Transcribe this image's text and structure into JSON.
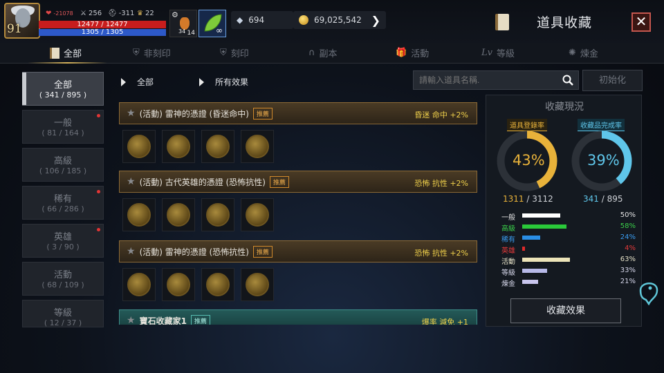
{
  "player": {
    "level": "91",
    "stat_a": "-21078",
    "stat_b": "256",
    "stat_c": "-311",
    "stat_d": "22",
    "hp": "12477 / 12477",
    "mp": "1305 / 1305",
    "slot1_count": "34",
    "slot1_sub": "14",
    "slot2_badge": "∞"
  },
  "currency": {
    "gems": "694",
    "gold": "69,025,542"
  },
  "header": {
    "title": "道具收藏",
    "close": "✕"
  },
  "tabs": [
    "全部",
    "非刻印",
    "刻印",
    "副本",
    "活動",
    "等級",
    "煉金"
  ],
  "sidebar": [
    {
      "name": "全部",
      "count": "( 341 / 895 )"
    },
    {
      "name": "一般",
      "count": "( 81 / 164 )"
    },
    {
      "name": "高級",
      "count": "( 106 / 185 )"
    },
    {
      "name": "稀有",
      "count": "( 66 / 286 )"
    },
    {
      "name": "英雄",
      "count": "( 3 / 90 )"
    },
    {
      "name": "活動",
      "count": "( 68 / 109 )"
    },
    {
      "name": "等級",
      "count": "( 12 / 37 )"
    }
  ],
  "filters": {
    "category": "全部",
    "effect": "所有效果"
  },
  "search": {
    "placeholder": "請輸入道具名稱."
  },
  "reset_label": "初始化",
  "items": [
    {
      "name": "(活動) 雷神的憑證 (昏迷命中)",
      "tag": "推薦",
      "effect": "昏迷 命中 +2%"
    },
    {
      "name": "(活動) 古代英雄的憑證 (恐怖抗性)",
      "tag": "推薦",
      "effect": "恐怖 抗性 +2%"
    },
    {
      "name": "(活動) 雷神的憑證 (恐怖抗性)",
      "tag": "推薦",
      "effect": "恐怖 抗性 +2%"
    },
    {
      "name": "寶石收藏家1",
      "tag": "推薦",
      "effect": "爆率 減免 +1"
    }
  ],
  "collection": {
    "title": "收藏現況",
    "reg_label": "道具登錄率",
    "reg_pct_text": "43%",
    "reg_pct": 0.43,
    "reg_have": "1311",
    "reg_total": " / 3112",
    "comp_label": "收藏品完成率",
    "comp_pct_text": "39%",
    "comp_pct": 0.39,
    "comp_have": "341",
    "comp_total": " / 895",
    "rows": [
      {
        "label": "一般",
        "pct_text": "50%",
        "pct": 0.5,
        "color": "#ffffff",
        "text_color": "#e6e6e6"
      },
      {
        "label": "高級",
        "pct_text": "58%",
        "pct": 0.58,
        "color": "#2ac93a",
        "text_color": "#3bd04a"
      },
      {
        "label": "稀有",
        "pct_text": "24%",
        "pct": 0.24,
        "color": "#2a8ee6",
        "text_color": "#3a9cf0"
      },
      {
        "label": "英雄",
        "pct_text": "4%",
        "pct": 0.04,
        "color": "#e02a2a",
        "text_color": "#e33a3a"
      },
      {
        "label": "活動",
        "pct_text": "63%",
        "pct": 0.63,
        "color": "#ece4b8",
        "text_color": "#e6e2c8"
      },
      {
        "label": "等級",
        "pct_text": "33%",
        "pct": 0.33,
        "color": "#b7b9e8",
        "text_color": "#d6d7ea"
      },
      {
        "label": "煉金",
        "pct_text": "21%",
        "pct": 0.21,
        "color": "#c9c6ee",
        "text_color": "#d6d7ea"
      }
    ],
    "button": "收藏效果"
  },
  "colors": {
    "gold_ring": "#e8b23a",
    "blue_ring": "#5fc6ea",
    "accent": "#d7b45c"
  }
}
